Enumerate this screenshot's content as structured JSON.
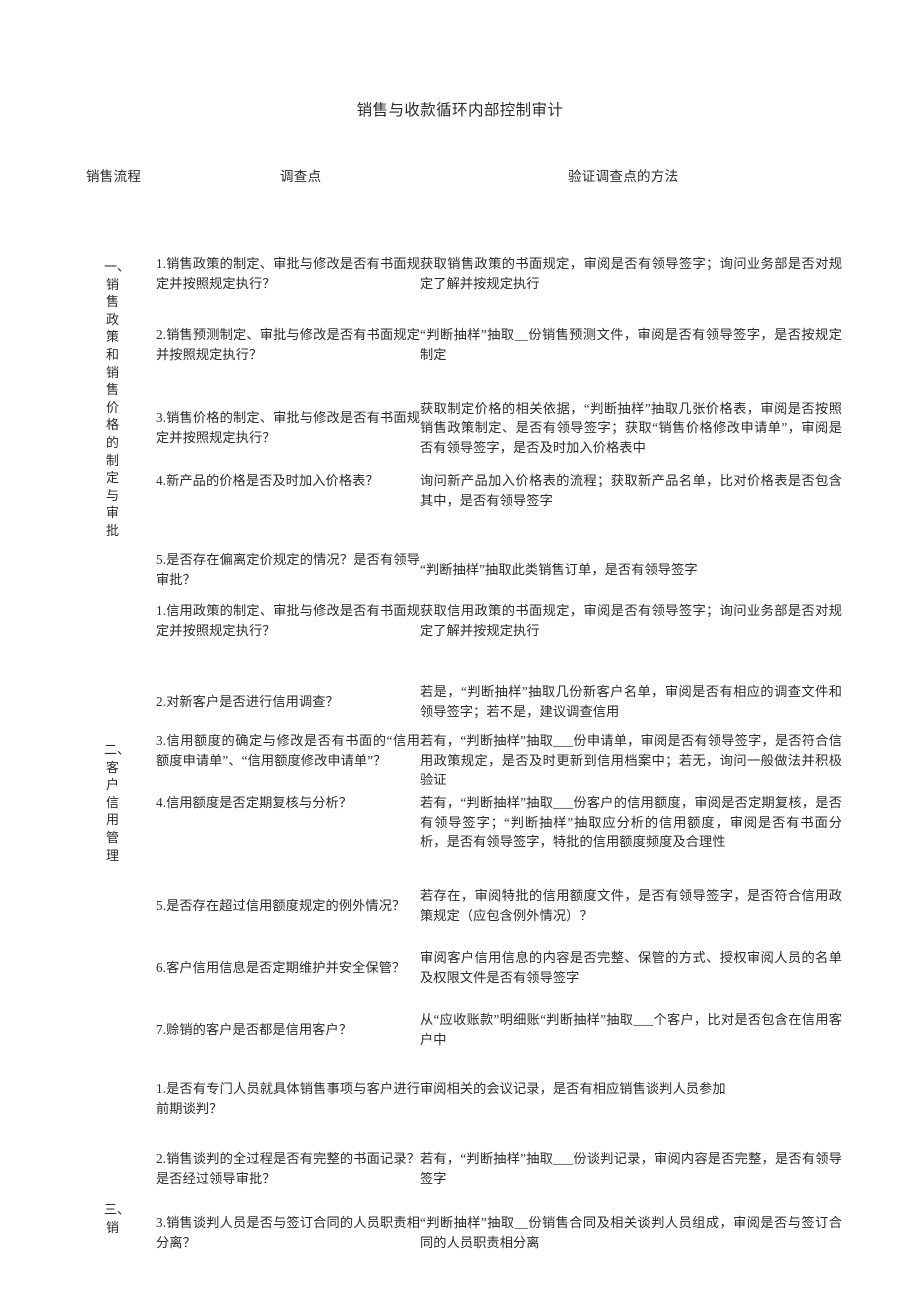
{
  "document": {
    "title": "销售与收款循环内部控制审计"
  },
  "table": {
    "headers": {
      "flow": "销售流程",
      "point": "调查点",
      "method": "验证调查点的方法"
    },
    "sections": [
      {
        "label": "一、销售政策和销售价格的制定与审批",
        "rows": [
          {
            "point": "1.销售政策的制定、审批与修改是否有书面规定并按照规定执行？",
            "method": "获取销售政策的书面规定，审阅是否有领导签字；询问业务部是否对规定了解并按规定执行"
          },
          {
            "point": "2.销售预测制定、审批与修改是否有书面规定并按照规定执行？",
            "method": "“判断抽样”抽取__份销售预测文件，审阅是否有领导签字，是否按规定制定"
          },
          {
            "point": "3.销售价格的制定、审批与修改是否有书面规定并按照规定执行？",
            "method": "获取制定价格的相关依据，“判断抽样”抽取几张价格表，审阅是否按照销售政策制定、是否有领导签字；获取“销售价格修改申请单”，审阅是否有领导签字，是否及时加入价格表中"
          },
          {
            "point": "4.新产品的价格是否及时加入价格表？",
            "method": "询问新产品加入价格表的流程；获取新产品名单，比对价格表是否包含其中，是否有领导签字"
          },
          {
            "point": "5.是否存在偏离定价规定的情况？是否有领导审批？",
            "method": "“判断抽样”抽取此类销售订单，是否有领导签字"
          }
        ]
      },
      {
        "label": "二、客户信用管理",
        "rows": [
          {
            "point": "1.信用政策的制定、审批与修改是否有书面规定并按照规定执行？",
            "method": "获取信用政策的书面规定，审阅是否有领导签字；询问业务部是否对规定了解并按规定执行"
          },
          {
            "point": "2.对新客户是否进行信用调查？",
            "method": "若是，“判断抽样”抽取几份新客户名单，审阅是否有相应的调查文件和领导签字；若不是，建议调查信用"
          },
          {
            "point": "3.信用额度的确定与修改是否有书面的“信用额度申请单”、“信用额度修改申请单”？",
            "method": "若有，“判断抽样”抽取___份申请单，审阅是否有领导签字，是否符合信用政策规定，是否及时更新到信用档案中；若无，询问一般做法并积极验证"
          },
          {
            "point": "4.信用额度是否定期复核与分析？",
            "method": "若有，“判断抽样”抽取___份客户的信用额度，审阅是否定期复核，是否有领导签字；“判断抽样”抽取应分析的信用额度，审阅是否有书面分析，是否有领导签字，特批的信用额度频度及合理性"
          },
          {
            "point": "5.是否存在超过信用额度规定的例外情况？",
            "method": "若存在，审阅特批的信用额度文件，是否有领导签字，是否符合信用政策规定（应包含例外情况）？"
          },
          {
            "point": "6.客户信用信息是否定期维护并安全保管？",
            "method": "审阅客户信用信息的内容是否完整、保管的方式、授权审阅人员的名单及权限文件是否有领导签字"
          },
          {
            "point": "7.赊销的客户是否都是信用客户？",
            "method": "从“应收账款”明细账“判断抽样”抽取___个客户，比对是否包含在信用客户中"
          }
        ]
      },
      {
        "label": "三、销",
        "rows": [
          {
            "point": "1.是否有专门人员就具体销售事项与客户进行前期谈判？",
            "method": "审阅相关的会议记录，是否有相应销售谈判人员参加"
          },
          {
            "point": "2.销售谈判的全过程是否有完整的书面记录？是否经过领导审批？",
            "method": "若有，“判断抽样”抽取___份谈判记录，审阅内容是否完整，是否有领导签字"
          },
          {
            "point": "3.销售谈判人员是否与签订合同的人员职责相分离？",
            "method": "“判断抽样”抽取__份销售合同及相关谈判人员组成，审阅是否与签订合同的人员职责相分离"
          }
        ]
      }
    ]
  }
}
